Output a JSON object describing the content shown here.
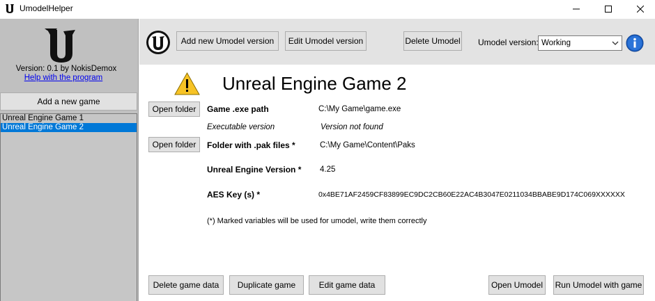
{
  "window": {
    "title": "UmodelHelper"
  },
  "sidebar": {
    "version_text": "Version: 0.1 by NokisDemox",
    "help_link": "Help with the program",
    "add_game_label": "Add a new game",
    "games": [
      "Unreal Engine Game 1",
      "Unreal Engine Game 2"
    ],
    "selected_game": "Unreal Engine Game 2"
  },
  "toolbar": {
    "add_version_label": "Add new Umodel version",
    "edit_version_label": "Edit Umodel version",
    "delete_umodel_label": "Delete Umodel",
    "umodel_version_label": "Umodel version:",
    "umodel_version_value": "Working"
  },
  "game": {
    "title": "Unreal Engine Game 2",
    "open_folder_label": "Open folder",
    "exe_path_label": "Game .exe path",
    "exe_path_value": "C:\\My Game\\game.exe",
    "exe_version_label": "Executable version",
    "exe_version_value": "Version not found",
    "pak_folder_label": "Folder with .pak files *",
    "pak_folder_value": "C:\\My Game\\Content\\Paks",
    "ue_version_label": "Unreal Engine Version *",
    "ue_version_value": "4.25",
    "aes_key_label": "AES Key (s) *",
    "aes_key_value": "0x4BE71AF2459CF83899EC9DC2CB60E22AC4B3047E0211034BBABE9D174C069XXXXXX",
    "note": "(*) Marked variables will be used for umodel, write them correctly"
  },
  "actions": {
    "delete_game_data": "Delete game data",
    "duplicate_game": "Duplicate game",
    "edit_game_data": "Edit game data",
    "open_umodel": "Open Umodel",
    "run_umodel": "Run Umodel with game"
  },
  "colors": {
    "selection": "#0078d7",
    "link": "#0000ee",
    "sidebar": "#c0c0c0",
    "toolbar": "#e3e3e3",
    "info": "#1e64c8",
    "warning": "#f7c325"
  }
}
